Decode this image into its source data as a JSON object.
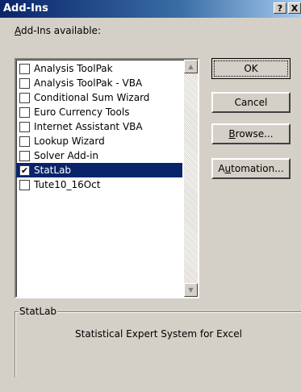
{
  "window": {
    "title": "Add-Ins",
    "help_label": "?",
    "close_label": "X"
  },
  "addins_label": {
    "accel": "A",
    "rest": "dd-Ins available:"
  },
  "items": [
    {
      "label": "Analysis ToolPak",
      "checked": false,
      "selected": false
    },
    {
      "label": "Analysis ToolPak - VBA",
      "checked": false,
      "selected": false
    },
    {
      "label": "Conditional Sum Wizard",
      "checked": false,
      "selected": false
    },
    {
      "label": "Euro Currency Tools",
      "checked": false,
      "selected": false
    },
    {
      "label": "Internet Assistant VBA",
      "checked": false,
      "selected": false
    },
    {
      "label": "Lookup Wizard",
      "checked": false,
      "selected": false
    },
    {
      "label": "Solver Add-in",
      "checked": false,
      "selected": false
    },
    {
      "label": "StatLab",
      "checked": true,
      "selected": true
    },
    {
      "label": "Tute10_16Oct",
      "checked": false,
      "selected": false
    }
  ],
  "buttons": {
    "ok": "OK",
    "cancel": "Cancel",
    "browse": {
      "accel": "B",
      "rest": "rowse..."
    },
    "automation": {
      "pre": "A",
      "accel": "u",
      "rest": "tomation..."
    }
  },
  "group": {
    "title": "StatLab",
    "description": "Statistical Expert System for Excel"
  },
  "icons": {
    "check": "✔",
    "scroll_up": "▲",
    "scroll_down": "▼"
  },
  "colors": {
    "selection": "#0a246a",
    "titlebar_start": "#0a246a",
    "titlebar_end": "#a6caf0",
    "face": "#d4d0c8"
  }
}
